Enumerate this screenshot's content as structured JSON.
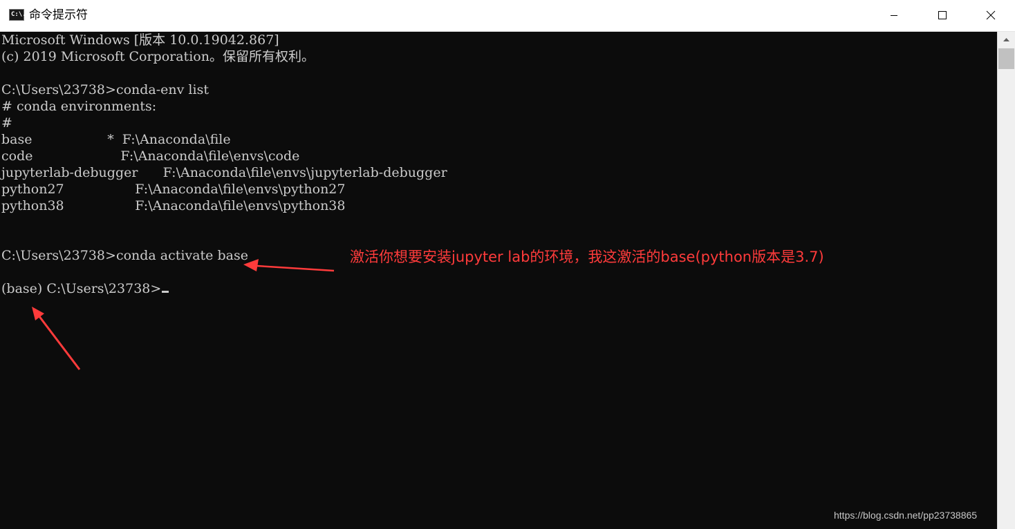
{
  "window": {
    "title": "命令提示符",
    "icon_text": "C:\\."
  },
  "terminal": {
    "lines": [
      "Microsoft Windows [版本 10.0.19042.867]",
      "(c) 2019 Microsoft Corporation。保留所有权利。",
      "",
      "C:\\Users\\23738>conda-env list",
      "# conda environments:",
      "#",
      "base                  *  F:\\Anaconda\\file",
      "code                     F:\\Anaconda\\file\\envs\\code",
      "jupyterlab-debugger      F:\\Anaconda\\file\\envs\\jupyterlab-debugger",
      "python27                 F:\\Anaconda\\file\\envs\\python27",
      "python38                 F:\\Anaconda\\file\\envs\\python38",
      "",
      "",
      "C:\\Users\\23738>conda activate base",
      "",
      "(base) C:\\Users\\23738>"
    ]
  },
  "annotation": {
    "text": "激活你想要安装jupyter lab的环境，我这激活的base(python版本是3.7)",
    "color": "#ff3b3b"
  },
  "watermark": "https://blog.csdn.net/pp23738865",
  "colors": {
    "terminal_bg": "#0c0c0c",
    "terminal_fg": "#cccccc",
    "titlebar_bg": "#ffffff"
  },
  "icons": {
    "minimize": "minimize-icon",
    "maximize": "maximize-icon",
    "close": "close-icon"
  }
}
